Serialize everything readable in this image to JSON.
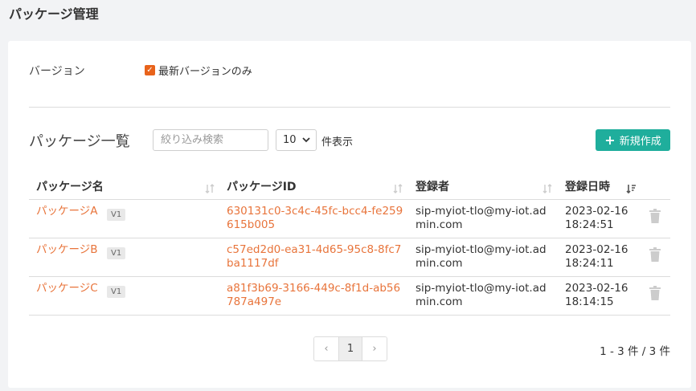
{
  "page": {
    "title": "パッケージ管理"
  },
  "filter": {
    "label": "バージョン",
    "latest_only_label": "最新バージョンのみ",
    "latest_only_checked": true
  },
  "list": {
    "title": "パッケージ一覧",
    "search_placeholder": "絞り込み検索",
    "page_size": "10",
    "page_size_suffix": "件表示",
    "new_button_label": "新規作成"
  },
  "table": {
    "headers": {
      "name": "パッケージ名",
      "id": "パッケージID",
      "registrant": "登録者",
      "date": "登録日時"
    },
    "rows": [
      {
        "name": "パッケージA",
        "version": "V1",
        "id_line1": "630131c0-3c4c-45fc-bcc4-fe259",
        "id_line2": "615b005",
        "registrant_line1": "sip-myiot-tlo@my-iot.ad",
        "registrant_line2": "min.com",
        "date": "2023-02-16",
        "time": "18:24:51"
      },
      {
        "name": "パッケージB",
        "version": "V1",
        "id_line1": "c57ed2d0-ea31-4d65-95c8-8fc7",
        "id_line2": "ba1117df",
        "registrant_line1": "sip-myiot-tlo@my-iot.ad",
        "registrant_line2": "min.com",
        "date": "2023-02-16",
        "time": "18:24:11"
      },
      {
        "name": "パッケージC",
        "version": "V1",
        "id_line1": "a81f3b69-3166-449c-8f1d-ab56",
        "id_line2": "787a497e",
        "registrant_line1": "sip-myiot-tlo@my-iot.ad",
        "registrant_line2": "min.com",
        "date": "2023-02-16",
        "time": "18:14:15"
      }
    ]
  },
  "pagination": {
    "prev": "‹",
    "current": "1",
    "next": "›",
    "count_text": "1 - 3 件 / 3 件"
  },
  "colors": {
    "accent": "#e8743b",
    "primary_button": "#1fae9c",
    "checkbox": "#e8631b"
  }
}
